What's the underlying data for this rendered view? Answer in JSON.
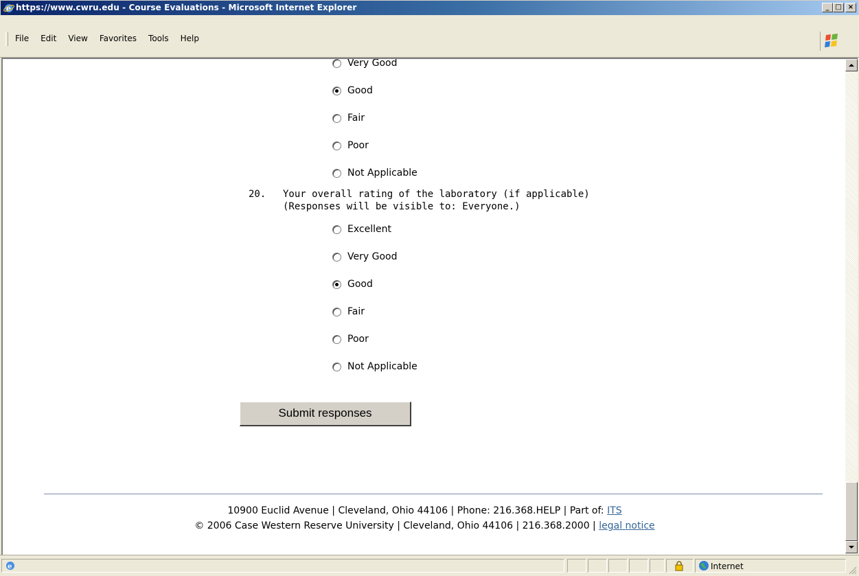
{
  "window": {
    "title": "https://www.cwru.edu - Course Evaluations - Microsoft Internet Explorer",
    "minimize": "_",
    "maximize": "□",
    "close": "×"
  },
  "menu": [
    "File",
    "Edit",
    "View",
    "Favorites",
    "Tools",
    "Help"
  ],
  "q19": {
    "options": [
      {
        "label": "Very Good",
        "checked": false
      },
      {
        "label": "Good",
        "checked": true
      },
      {
        "label": "Fair",
        "checked": false
      },
      {
        "label": "Poor",
        "checked": false
      },
      {
        "label": "Not Applicable",
        "checked": false
      }
    ]
  },
  "q20": {
    "number": "20.",
    "text": "Your overall rating of the laboratory (if applicable)",
    "visibility": "(Responses will be visible to: Everyone.)",
    "options": [
      {
        "label": "Excellent",
        "checked": false
      },
      {
        "label": "Very Good",
        "checked": false
      },
      {
        "label": "Good",
        "checked": true
      },
      {
        "label": "Fair",
        "checked": false
      },
      {
        "label": "Poor",
        "checked": false
      },
      {
        "label": "Not Applicable",
        "checked": false
      }
    ]
  },
  "submit_label": "Submit responses",
  "footer": {
    "line1_prefix": "10900 Euclid Avenue | Cleveland, Ohio 44106 | Phone: 216.368.HELP | Part of: ",
    "line1_link": "ITS",
    "line2_prefix": "© 2006 Case Western Reserve University | Cleveland, Ohio 44106 | 216.368.2000 | ",
    "line2_link": "legal notice"
  },
  "status": {
    "zone": "Internet"
  },
  "colors": {
    "link": "#336699",
    "title_bar_start": "#0a246a",
    "title_bar_end": "#a6caf0"
  }
}
